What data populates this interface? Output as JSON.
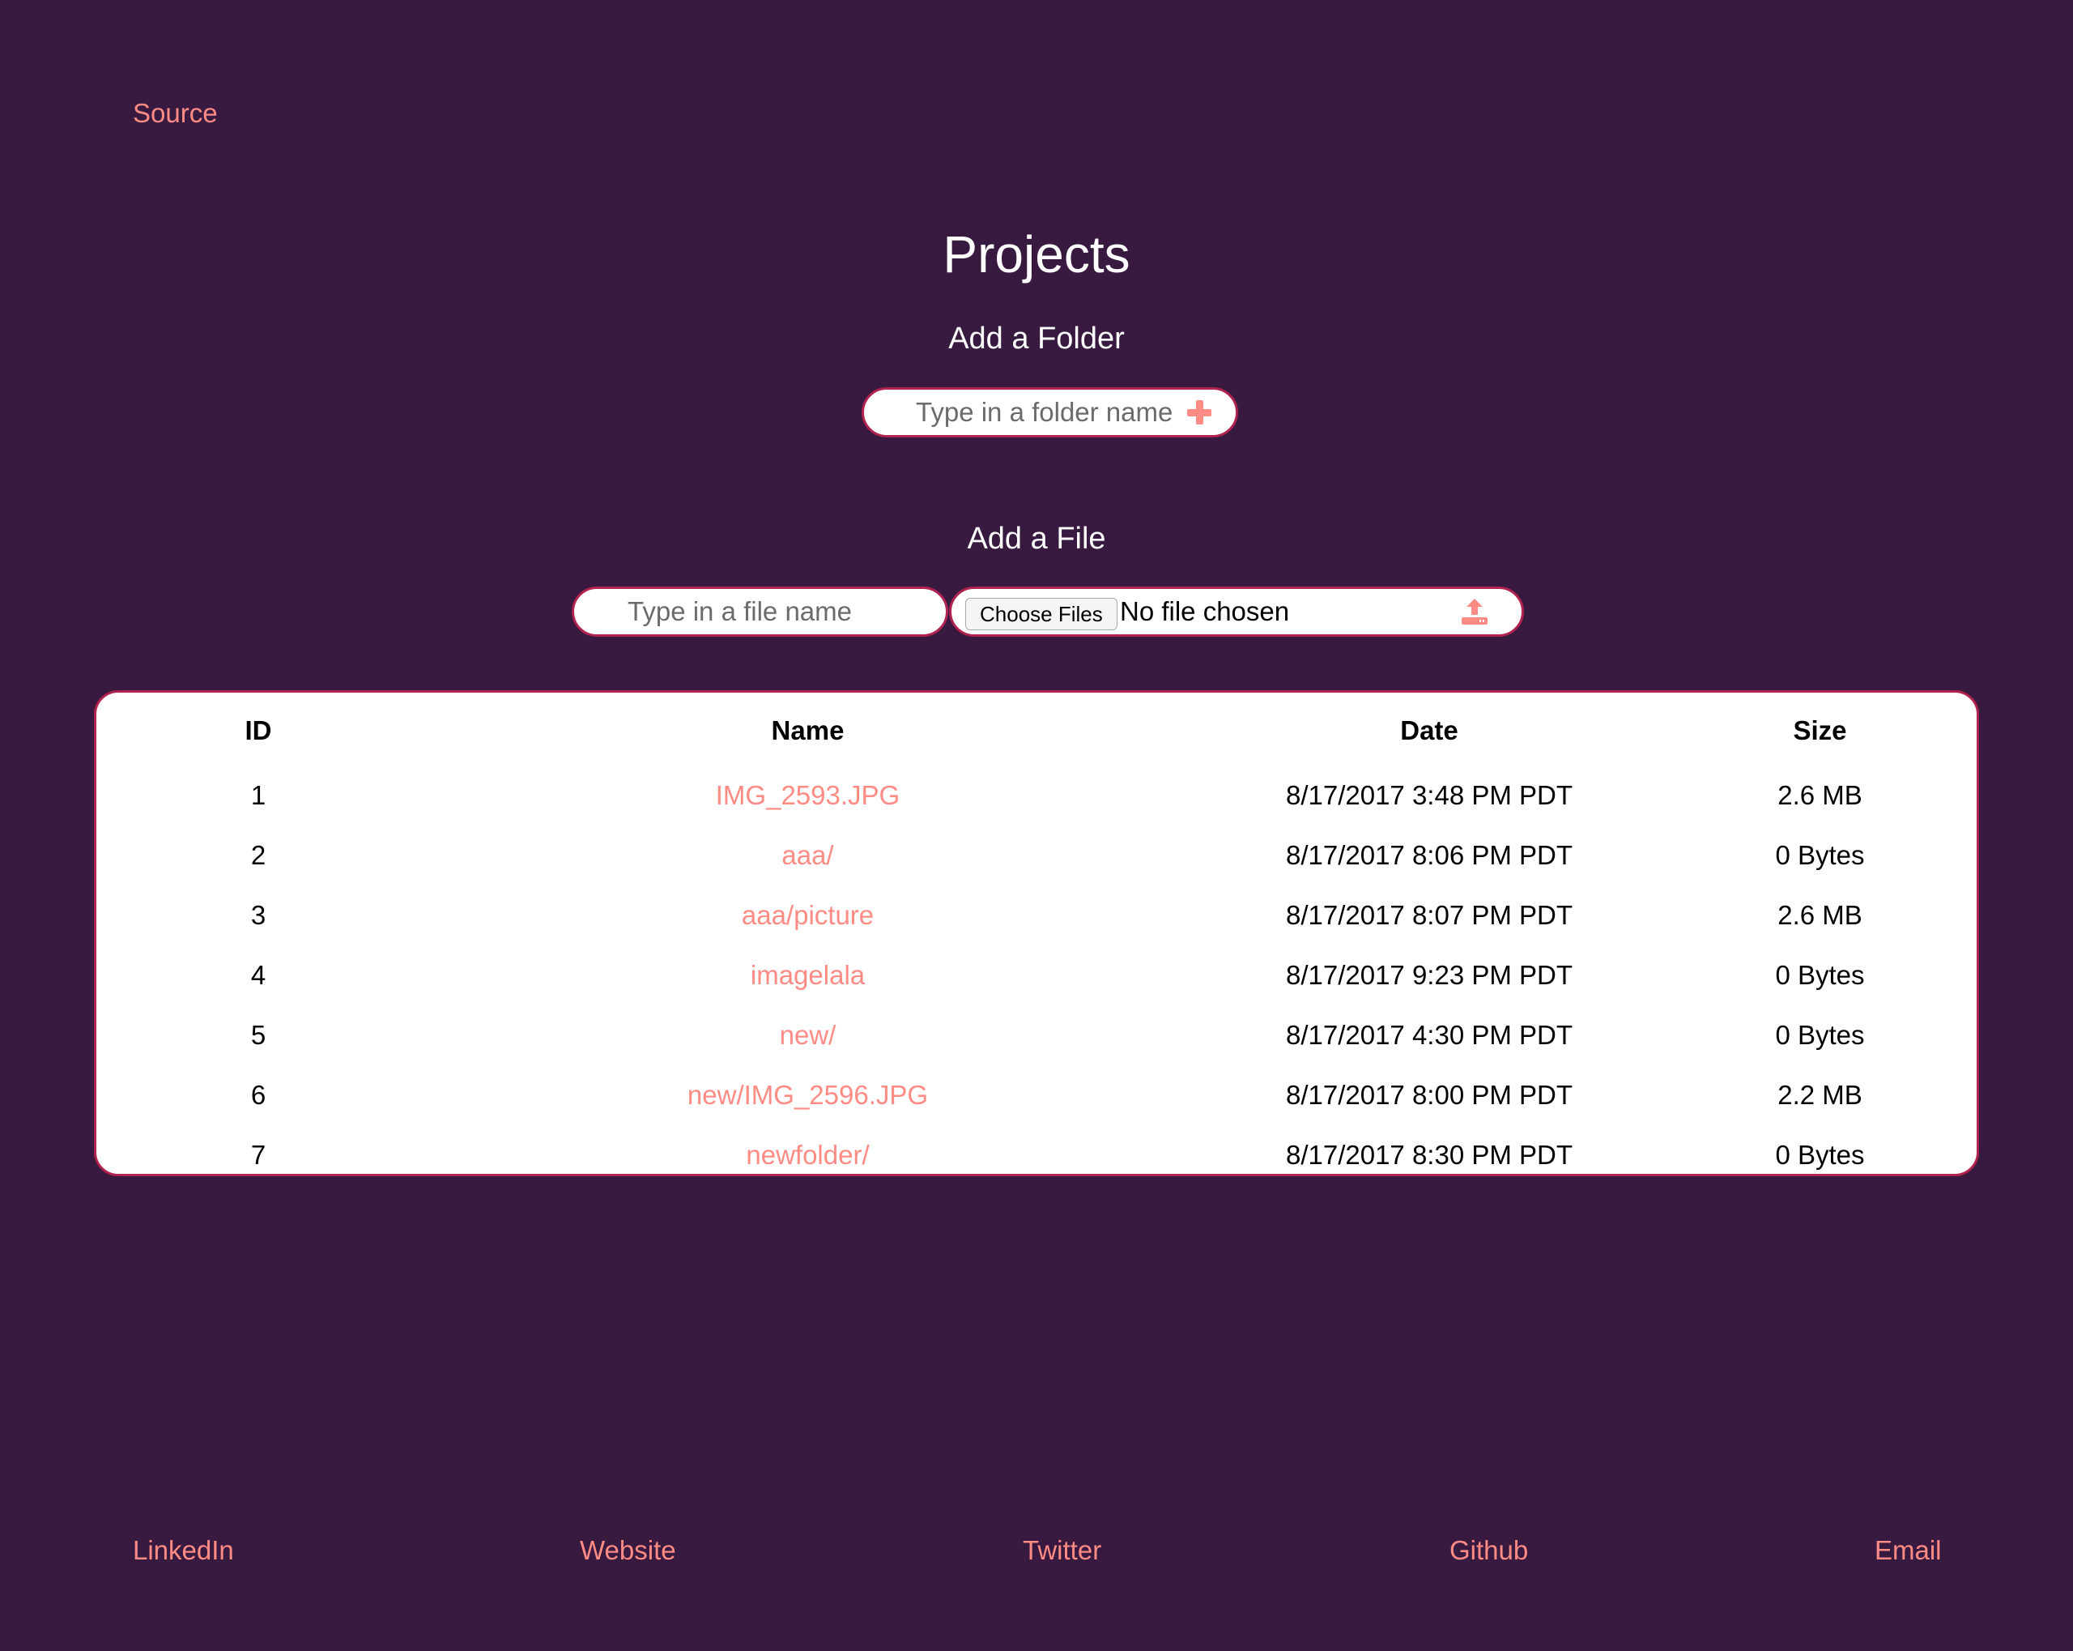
{
  "header": {
    "source_link": "Source"
  },
  "main": {
    "title": "Projects",
    "add_folder": {
      "label": "Add a Folder",
      "placeholder": "Type in a folder name"
    },
    "add_file": {
      "label": "Add a File",
      "name_placeholder": "Type in a file name",
      "choose_button": "Choose Files",
      "file_status": "No file chosen"
    }
  },
  "table": {
    "headers": [
      "ID",
      "Name",
      "Date",
      "Size"
    ],
    "rows": [
      {
        "id": "1",
        "name": "IMG_2593.JPG",
        "date": "8/17/2017 3:48 PM PDT",
        "size": "2.6 MB"
      },
      {
        "id": "2",
        "name": "aaa/",
        "date": "8/17/2017 8:06 PM PDT",
        "size": "0 Bytes"
      },
      {
        "id": "3",
        "name": "aaa/picture",
        "date": "8/17/2017 8:07 PM PDT",
        "size": "2.6 MB"
      },
      {
        "id": "4",
        "name": "imagelala",
        "date": "8/17/2017 9:23 PM PDT",
        "size": "0 Bytes"
      },
      {
        "id": "5",
        "name": "new/",
        "date": "8/17/2017 4:30 PM PDT",
        "size": "0 Bytes"
      },
      {
        "id": "6",
        "name": "new/IMG_2596.JPG",
        "date": "8/17/2017 8:00 PM PDT",
        "size": "2.2 MB"
      },
      {
        "id": "7",
        "name": "newfolder/",
        "date": "8/17/2017 8:30 PM PDT",
        "size": "0 Bytes"
      }
    ]
  },
  "footer": {
    "linkedin": "LinkedIn",
    "website": "Website",
    "twitter": "Twitter",
    "github": "Github",
    "email": "Email"
  },
  "colors": {
    "background": "#38193f",
    "accent": "#ff8b85",
    "border": "#b0224f"
  },
  "icons": {
    "add_folder": "plus-icon",
    "upload": "upload-icon"
  }
}
